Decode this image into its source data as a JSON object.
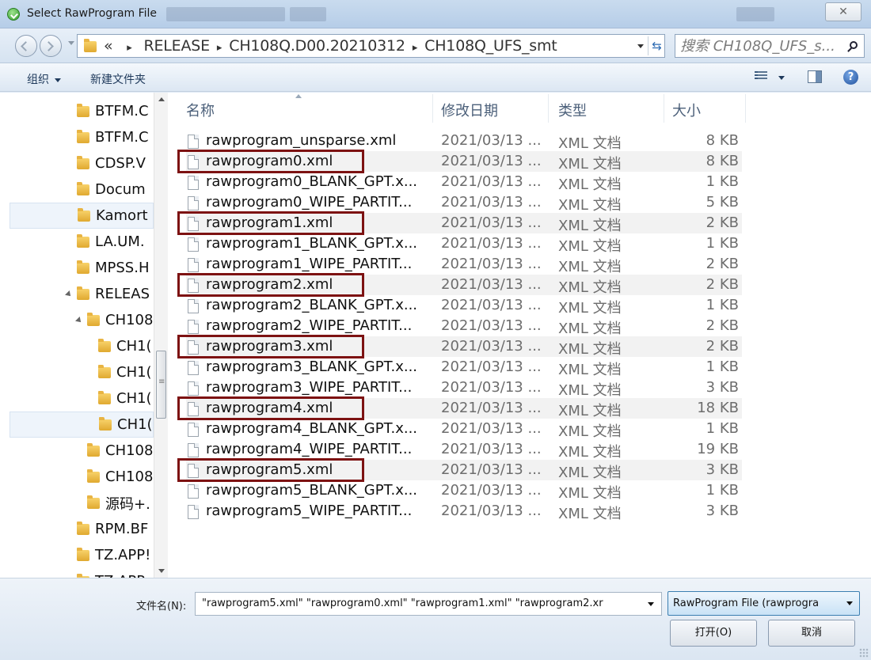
{
  "window": {
    "title": "Select RawProgram File",
    "close_label": "✕"
  },
  "address": {
    "crumb_prefix": "«",
    "crumbs": [
      "RELEASE",
      "CH108Q.D00.20210312",
      "CH108Q_UFS_smt"
    ],
    "separator": "▸",
    "search_placeholder": "搜索 CH108Q_UFS_s..."
  },
  "toolbar": {
    "organize_label": "组织",
    "new_folder_label": "新建文件夹",
    "help_label": "?"
  },
  "nav_tree": [
    {
      "label": "BTFM.C",
      "indent": 0
    },
    {
      "label": "BTFM.C",
      "indent": 0
    },
    {
      "label": "CDSP.V",
      "indent": 0
    },
    {
      "label": "Docum",
      "indent": 0
    },
    {
      "label": "Kamort",
      "indent": 0,
      "selected": true
    },
    {
      "label": "LA.UM.",
      "indent": 0
    },
    {
      "label": "MPSS.H",
      "indent": 0
    },
    {
      "label": "RELEAS",
      "indent": 0,
      "expanded": true
    },
    {
      "label": "CH108",
      "indent": 1,
      "expanded": true
    },
    {
      "label": "CH1(",
      "indent": 2
    },
    {
      "label": "CH1(",
      "indent": 2
    },
    {
      "label": "CH1(",
      "indent": 2
    },
    {
      "label": "CH1(",
      "indent": 2,
      "selected": true
    },
    {
      "label": "CH108",
      "indent": 1
    },
    {
      "label": "CH108",
      "indent": 1
    },
    {
      "label": "源码+.",
      "indent": 1
    },
    {
      "label": "RPM.BF",
      "indent": 0
    },
    {
      "label": "TZ.APP!",
      "indent": 0
    },
    {
      "label": "TZ.APP",
      "indent": 0
    }
  ],
  "columns": {
    "name": "名称",
    "date": "修改日期",
    "type": "类型",
    "size": "大小"
  },
  "files": [
    {
      "name": "rawprogram_unsparse.xml",
      "date": "2021/03/13 ...",
      "type": "XML 文档",
      "size": "8 KB"
    },
    {
      "name": "rawprogram0.xml",
      "date": "2021/03/13 ...",
      "type": "XML 文档",
      "size": "8 KB",
      "selected": true
    },
    {
      "name": "rawprogram0_BLANK_GPT.x...",
      "date": "2021/03/13 ...",
      "type": "XML 文档",
      "size": "1 KB"
    },
    {
      "name": "rawprogram0_WIPE_PARTIT...",
      "date": "2021/03/13 ...",
      "type": "XML 文档",
      "size": "5 KB"
    },
    {
      "name": "rawprogram1.xml",
      "date": "2021/03/13 ...",
      "type": "XML 文档",
      "size": "2 KB",
      "selected": true
    },
    {
      "name": "rawprogram1_BLANK_GPT.x...",
      "date": "2021/03/13 ...",
      "type": "XML 文档",
      "size": "1 KB"
    },
    {
      "name": "rawprogram1_WIPE_PARTIT...",
      "date": "2021/03/13 ...",
      "type": "XML 文档",
      "size": "2 KB"
    },
    {
      "name": "rawprogram2.xml",
      "date": "2021/03/13 ...",
      "type": "XML 文档",
      "size": "2 KB",
      "selected": true
    },
    {
      "name": "rawprogram2_BLANK_GPT.x...",
      "date": "2021/03/13 ...",
      "type": "XML 文档",
      "size": "1 KB"
    },
    {
      "name": "rawprogram2_WIPE_PARTIT...",
      "date": "2021/03/13 ...",
      "type": "XML 文档",
      "size": "2 KB"
    },
    {
      "name": "rawprogram3.xml",
      "date": "2021/03/13 ...",
      "type": "XML 文档",
      "size": "2 KB",
      "selected": true
    },
    {
      "name": "rawprogram3_BLANK_GPT.x...",
      "date": "2021/03/13 ...",
      "type": "XML 文档",
      "size": "1 KB"
    },
    {
      "name": "rawprogram3_WIPE_PARTIT...",
      "date": "2021/03/13 ...",
      "type": "XML 文档",
      "size": "3 KB"
    },
    {
      "name": "rawprogram4.xml",
      "date": "2021/03/13 ...",
      "type": "XML 文档",
      "size": "18 KB",
      "selected": true
    },
    {
      "name": "rawprogram4_BLANK_GPT.x...",
      "date": "2021/03/13 ...",
      "type": "XML 文档",
      "size": "1 KB"
    },
    {
      "name": "rawprogram4_WIPE_PARTIT...",
      "date": "2021/03/13 ...",
      "type": "XML 文档",
      "size": "19 KB"
    },
    {
      "name": "rawprogram5.xml",
      "date": "2021/03/13 ...",
      "type": "XML 文档",
      "size": "3 KB",
      "selected": true
    },
    {
      "name": "rawprogram5_BLANK_GPT.x...",
      "date": "2021/03/13 ...",
      "type": "XML 文档",
      "size": "1 KB"
    },
    {
      "name": "rawprogram5_WIPE_PARTIT...",
      "date": "2021/03/13 ...",
      "type": "XML 文档",
      "size": "3 KB"
    }
  ],
  "footer": {
    "filename_label": "文件名(N):",
    "filename_value": "\"rawprogram5.xml\" \"rawprogram0.xml\" \"rawprogram1.xml\" \"rawprogram2.xr",
    "filter_value": "RawProgram File (rawprogra",
    "open_label": "打开(O)",
    "cancel_label": "取消"
  },
  "colors": {
    "highlight_border": "#7d1212",
    "selected_row": "#f2f2f2",
    "filter_border": "#3c7fb1"
  }
}
